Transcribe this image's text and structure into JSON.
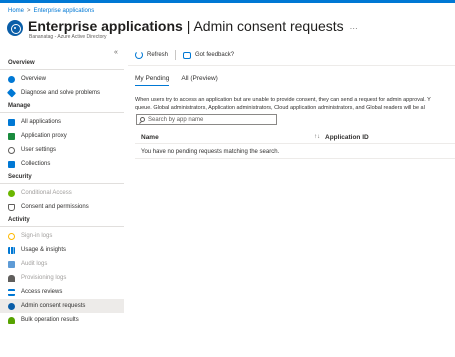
{
  "breadcrumb": {
    "home": "Home",
    "separator": ">",
    "current": "Enterprise applications"
  },
  "header": {
    "title_bold": "Enterprise applications",
    "title_rest": " | Admin consent requests",
    "more": "···",
    "subtitle": "Bananatag - Azure Active Directory",
    "collapse": "«"
  },
  "sidebar": {
    "sections": [
      {
        "label": "Overview",
        "items": [
          {
            "label": "Overview",
            "icon": "info-icon"
          },
          {
            "label": "Diagnose and solve problems",
            "icon": "wrench-icon"
          }
        ]
      },
      {
        "label": "Manage",
        "items": [
          {
            "label": "All applications",
            "icon": "grid-icon"
          },
          {
            "label": "Application proxy",
            "icon": "proxy-icon"
          },
          {
            "label": "User settings",
            "icon": "gear-icon"
          },
          {
            "label": "Collections",
            "icon": "collections-icon"
          }
        ]
      },
      {
        "label": "Security",
        "items": [
          {
            "label": "Conditional Access",
            "icon": "conditional-access-icon",
            "disabled": true
          },
          {
            "label": "Consent and permissions",
            "icon": "shield-icon"
          }
        ]
      },
      {
        "label": "Activity",
        "items": [
          {
            "label": "Sign-in logs",
            "icon": "sign-in-icon",
            "disabled": true
          },
          {
            "label": "Usage & insights",
            "icon": "chart-icon"
          },
          {
            "label": "Audit logs",
            "icon": "audit-icon",
            "disabled": true
          },
          {
            "label": "Provisioning logs",
            "icon": "person-icon",
            "disabled": true
          },
          {
            "label": "Access reviews",
            "icon": "list-icon"
          },
          {
            "label": "Admin consent requests",
            "icon": "admin-consent-icon",
            "selected": true
          },
          {
            "label": "Bulk operation results",
            "icon": "bulk-icon"
          }
        ]
      }
    ]
  },
  "toolbar": {
    "refresh": "Refresh",
    "feedback": "Got feedback?"
  },
  "tabs": [
    {
      "label": "My Pending",
      "active": true
    },
    {
      "label": "All (Preview)",
      "active": false
    }
  ],
  "description": {
    "line1": "When users try to access an application but are unable to provide consent, they can send a request for admin approval. Y",
    "line2": "queue. Global administrators, Application administrators, Cloud application administrators, and Global readers will be al"
  },
  "search": {
    "placeholder": "Search by app name"
  },
  "table": {
    "columns": [
      {
        "label": "Name"
      },
      {
        "label": "Application ID"
      }
    ],
    "sort_icon": "↑↓",
    "empty_message": "You have no pending requests matching the search."
  },
  "colors": {
    "accent": "#0078d4",
    "selected_bg": "#edebe9",
    "disabled_text": "#a19f9d"
  }
}
